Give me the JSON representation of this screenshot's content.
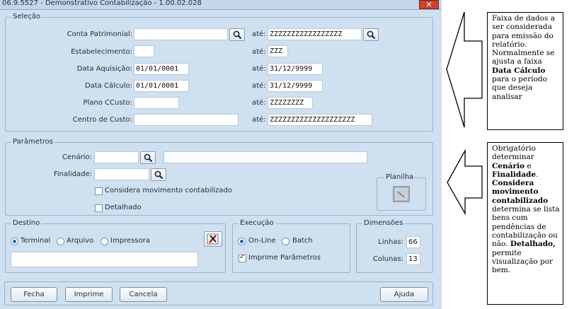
{
  "window": {
    "title": "06.9.5527 - Demonstrativo Contabilização - 1.00.02.028",
    "close_glyph": "✕"
  },
  "selecao": {
    "legend": "Seleção",
    "ate_label": "até:",
    "rows": [
      {
        "label": "Conta Patrimonial:",
        "from": "",
        "to": "ZZZZZZZZZZZZZZZZZ"
      },
      {
        "label": "Estabelecimento:",
        "from": "",
        "to": "ZZZ"
      },
      {
        "label": "Data Aquisição:",
        "from": "01/01/0001",
        "to": "31/12/9999"
      },
      {
        "label": "Data Cálculo:",
        "from": "01/01/0001",
        "to": "31/12/9999"
      },
      {
        "label": "Plano CCusto:",
        "from": "",
        "to": "ZZZZZZZZ"
      },
      {
        "label": "Centro de Custo:",
        "from": "",
        "to": "ZZZZZZZZZZZZZZZZZZZZ"
      }
    ]
  },
  "parametros": {
    "legend": "Parâmetros",
    "cenario_label": "Cenário:",
    "cenario_value": "",
    "cenario_desc": "",
    "finalidade_label": "Finalidade:",
    "finalidade_value": "",
    "considera_label": "Considera movimento contabilizado",
    "considera_checked": false,
    "detalhado_label": "Detalhado",
    "detalhado_checked": false,
    "planilha_legend": "Planilha"
  },
  "destino": {
    "legend": "Destino",
    "options": [
      "Terminal",
      "Arquivo",
      "Impressora"
    ],
    "selected": "Terminal",
    "path_value": ""
  },
  "execucao": {
    "legend": "Execução",
    "options": [
      "On-Line",
      "Batch"
    ],
    "selected": "On-Line",
    "imprime_label": "Imprime Parâmetros",
    "imprime_checked": true
  },
  "dimensoes": {
    "legend": "Dimensões",
    "linhas_label": "Linhas:",
    "linhas_value": "66",
    "colunas_label": "Colunas:",
    "colunas_value": "13"
  },
  "buttons": {
    "fecha": "Fecha",
    "imprime": "Imprime",
    "cancela": "Cancela",
    "ajuda": "Ajuda"
  },
  "annotations": {
    "top": {
      "line1": "Faixa de dados a ser considerada para emissão do relatório. Normalmente se ajusta a faixa ",
      "bold1": "Data Cálculo",
      "line2": " para o período que deseja analisar"
    },
    "bottom": {
      "t1": "Obrigatório determinar ",
      "b1": "Cenário",
      "t2": " e ",
      "b2": "Finalidade",
      "t3": ". ",
      "b3": "Considera movimento contabilizado",
      "t4": " determina se lista bens com pendências de contabilização ou não. ",
      "b4": "Detalhado,",
      "t5": " permite visualização por bem."
    }
  }
}
